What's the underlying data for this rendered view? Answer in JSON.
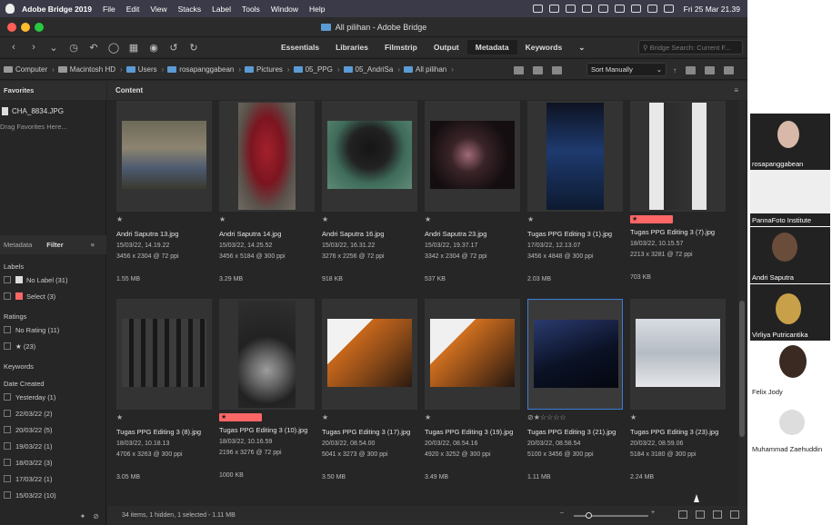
{
  "menubar": {
    "app": "Adobe Bridge 2019",
    "items": [
      "File",
      "Edit",
      "View",
      "Stacks",
      "Label",
      "Tools",
      "Window",
      "Help"
    ],
    "clock": "Fri 25 Mar  21.39"
  },
  "window": {
    "title": "All pilihan - Adobe Bridge"
  },
  "workspaces": [
    "Essentials",
    "Libraries",
    "Filmstrip",
    "Output",
    "Metadata",
    "Keywords"
  ],
  "active_workspace": "Metadata",
  "search": {
    "placeholder": "Bridge Search: Current F..."
  },
  "breadcrumb": [
    "Computer",
    "Macintosh HD",
    "Users",
    "rosapanggabean",
    "Pictures",
    "05_PPG",
    "05_AndriSa",
    "All pilihan"
  ],
  "sort": {
    "label": "Sort Manually"
  },
  "favorites": {
    "tab": "Favorites",
    "item": "CHA_8834.JPG",
    "hint": "Drag Favorites Here..."
  },
  "filter_panel": {
    "tabs": [
      "Metadata",
      "Filter"
    ],
    "labels_heading": "Labels",
    "labels": [
      {
        "text": "No Label",
        "count": "(31)"
      },
      {
        "text": "Select",
        "count": "(3)"
      }
    ],
    "ratings_heading": "Ratings",
    "ratings": [
      {
        "text": "No Rating",
        "count": "(11)"
      },
      {
        "text": "★",
        "count": "(23)"
      }
    ],
    "keywords_heading": "Keywords",
    "date_heading": "Date Created",
    "dates": [
      {
        "text": "Yesterday",
        "count": "(1)"
      },
      {
        "text": "22/03/22",
        "count": "(2)"
      },
      {
        "text": "20/03/22",
        "count": "(5)"
      },
      {
        "text": "19/03/22",
        "count": "(1)"
      },
      {
        "text": "18/03/22",
        "count": "(3)"
      },
      {
        "text": "17/03/22",
        "count": "(1)"
      },
      {
        "text": "15/03/22",
        "count": "(10)"
      }
    ]
  },
  "content": {
    "tab": "Content",
    "items": [
      {
        "name": "Andri Saputra 13.jpg",
        "date": "15/03/22, 14.19.22",
        "dims": "3456 x 2304 @ 72 ppi",
        "size": "1.55 MB",
        "rating": "★",
        "label": ""
      },
      {
        "name": "Andri Saputra 14.jpg",
        "date": "15/03/22, 14.25.52",
        "dims": "3456 x 5184 @ 300 ppi",
        "size": "3.29 MB",
        "rating": "★",
        "label": ""
      },
      {
        "name": "Andri Saputra 16.jpg",
        "date": "15/03/22, 16.31.22",
        "dims": "3276 x 2256 @ 72 ppi",
        "size": "918 KB",
        "rating": "★",
        "label": ""
      },
      {
        "name": "Andri Saputra 23.jpg",
        "date": "15/03/22, 19.37.17",
        "dims": "3342 x 2304 @ 72 ppi",
        "size": "537 KB",
        "rating": "★",
        "label": ""
      },
      {
        "name": "Tugas PPG Editing  3 (1).jpg",
        "date": "17/03/22, 12.13.07",
        "dims": "3456 x 4848 @ 300 ppi",
        "size": "2.03 MB",
        "rating": "★",
        "label": ""
      },
      {
        "name": "Tugas PPG Editing  3 (7).jpg",
        "date": "18/03/22, 10.15.57",
        "dims": "2213 x 3281 @ 72 ppi",
        "size": "703 KB",
        "rating": "",
        "label": "★"
      },
      {
        "name": "Tugas PPG Editing  3 (8).jpg",
        "date": "18/03/22, 10.18.13",
        "dims": "4706 x 3263 @ 300 ppi",
        "size": "3.05 MB",
        "rating": "★",
        "label": ""
      },
      {
        "name": "Tugas PPG Editing  3 (10).jpg",
        "date": "18/03/22, 10.16.59",
        "dims": "2196 x 3276 @ 72 ppi",
        "size": "1000 KB",
        "rating": "",
        "label": "★"
      },
      {
        "name": "Tugas PPG Editing  3 (17).jpg",
        "date": "20/03/22, 08.54.00",
        "dims": "5041 x 3273 @ 300 ppi",
        "size": "3.50 MB",
        "rating": "★",
        "label": ""
      },
      {
        "name": "Tugas PPG Editing  3 (19).jpg",
        "date": "20/03/22, 08.54.16",
        "dims": "4920 x 3252 @ 300 ppi",
        "size": "3.49 MB",
        "rating": "★",
        "label": ""
      },
      {
        "name": "Tugas PPG Editing  3 (21).jpg",
        "date": "20/03/22, 08.58.54",
        "dims": "5100 x 3456 @ 300 ppi",
        "size": "1.11 MB",
        "rating": "⊘★☆☆☆☆",
        "label": ""
      },
      {
        "name": "Tugas PPG Editing  3 (23).jpg",
        "date": "20/03/22, 08.59.06",
        "dims": "5184 x 3180 @ 300 ppi",
        "size": "2.24 MB",
        "rating": "★",
        "label": ""
      }
    ]
  },
  "status": "34 items, 1 hidden, 1 selected - 1.11 MB",
  "participants": [
    "rosapanggabean",
    "PannaFoto Institute",
    "Andri Saputra",
    "Virliya Putricantika",
    "Felix Jody",
    "Muhammad Zaehuddin"
  ]
}
